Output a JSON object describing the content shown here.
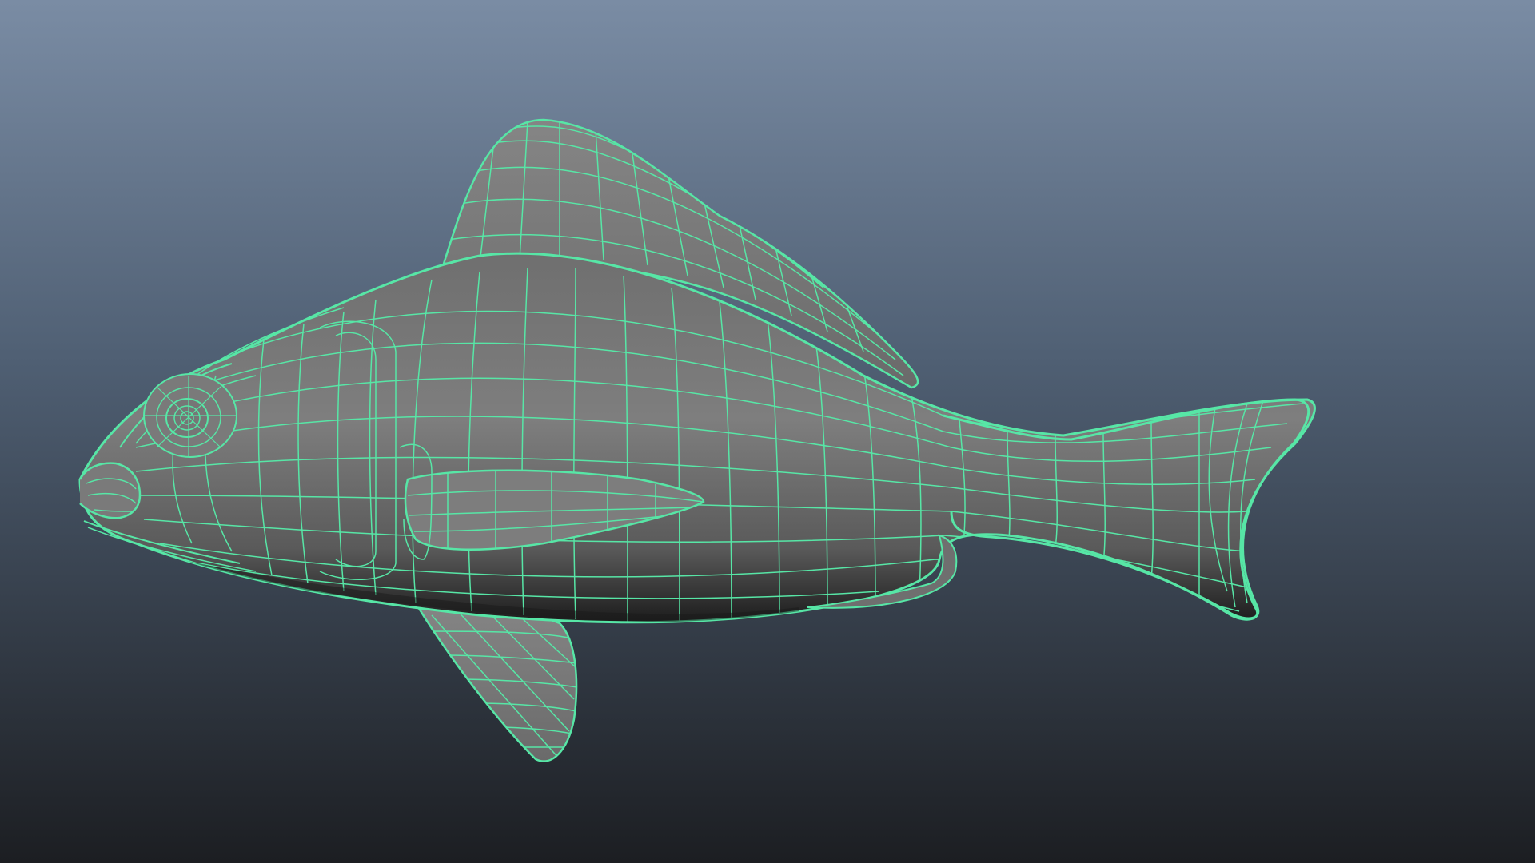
{
  "viewport": {
    "background": {
      "top_color": "#7a8ca4",
      "mid_color": "#4f5f73",
      "bottom_color": "#1c1e22"
    },
    "model": {
      "name": "fish-model",
      "shading": "smooth-shaded-with-wireframe",
      "surface_color": "#7b7b7b",
      "surface_shadow_color": "#2a2a2a",
      "wireframe_color": "#57e6a6",
      "selected": true
    }
  }
}
